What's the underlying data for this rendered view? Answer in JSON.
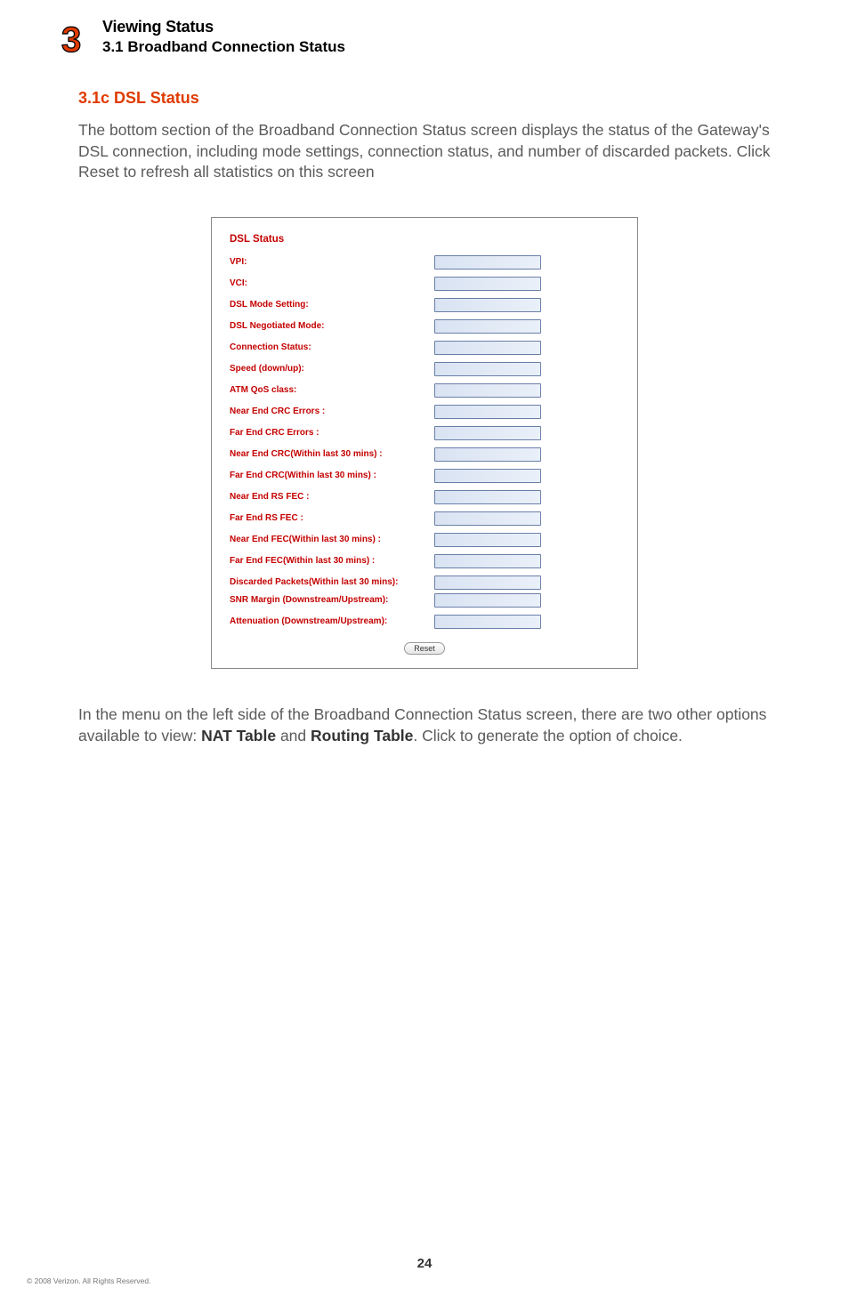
{
  "header": {
    "chapter_number": "3",
    "title_main": "Viewing Status",
    "title_sub": "3.1  Broadband Connection Status"
  },
  "section": {
    "heading": "3.1c  DSL Status",
    "paragraph1": "The bottom section of the Broadband Connection Status screen displays the status of the Gateway's DSL connection, including mode settings, connection status, and number of discarded packets. Click Reset to refresh all statistics on this screen",
    "paragraph2_pre": "In the menu on the left side of the Broadband Connection Status screen, there are two other options available to view: ",
    "paragraph2_nat": "NAT Table",
    "paragraph2_mid": " and ",
    "paragraph2_routing": "Routing Table",
    "paragraph2_end": ". Click to generate the option of choice."
  },
  "figure": {
    "title": "DSL Status",
    "rows": [
      {
        "label": "VPI:"
      },
      {
        "label": "VCI:"
      },
      {
        "label": "DSL Mode Setting:"
      },
      {
        "label": "DSL Negotiated Mode:"
      },
      {
        "label": "Connection Status:"
      },
      {
        "label": "Speed (down/up):"
      },
      {
        "label": "ATM QoS class:"
      },
      {
        "label": "Near End CRC Errors :"
      },
      {
        "label": "Far End CRC Errors :"
      },
      {
        "label": "Near End CRC(Within last 30 mins) :"
      },
      {
        "label": "Far End CRC(Within last 30 mins) :"
      },
      {
        "label": "Near End RS FEC :"
      },
      {
        "label": "Far End RS FEC :"
      },
      {
        "label": "Near End FEC(Within last 30 mins) :"
      },
      {
        "label": "Far End FEC(Within last 30 mins) :"
      },
      {
        "label": "Discarded Packets(Within last 30 mins):"
      },
      {
        "label": "SNR Margin (Downstream/Upstream):"
      },
      {
        "label": "Attenuation (Downstream/Upstream):"
      }
    ],
    "button": "Reset"
  },
  "footer": {
    "page_number": "24",
    "copyright": "© 2008 Verizon. All Rights Reserved."
  }
}
